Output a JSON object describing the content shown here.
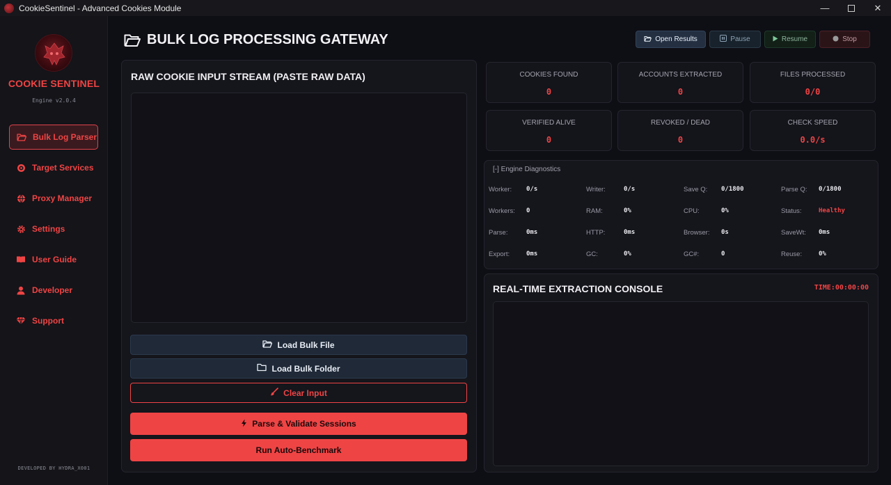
{
  "window": {
    "title": "CookieSentinel - Advanced Cookies Module"
  },
  "sidebar": {
    "brand": "COOKIE SENTINEL",
    "version": "Engine v2.0.4",
    "footer": "DEVELOPED BY HYDRA_X001",
    "items": [
      {
        "label": "Bulk Log Parser",
        "icon": "folder-open-icon",
        "active": true
      },
      {
        "label": "Target Services",
        "icon": "target-icon"
      },
      {
        "label": "Proxy Manager",
        "icon": "globe-icon"
      },
      {
        "label": "Settings",
        "icon": "gear-icon"
      },
      {
        "label": "User Guide",
        "icon": "book-icon"
      },
      {
        "label": "Developer",
        "icon": "user-icon"
      },
      {
        "label": "Support",
        "icon": "gem-icon"
      }
    ]
  },
  "header": {
    "title": "BULK LOG PROCESSING GATEWAY",
    "buttons": {
      "open_results": "Open Results",
      "pause": "Pause",
      "resume": "Resume",
      "stop": "Stop"
    }
  },
  "input_panel": {
    "title": "RAW COOKIE INPUT STREAM (PASTE RAW DATA)",
    "textarea_value": "",
    "buttons": {
      "load_file": "Load Bulk File",
      "load_folder": "Load Bulk Folder",
      "clear": "Clear Input",
      "parse": "Parse & Validate Sessions",
      "benchmark": "Run Auto-Benchmark"
    }
  },
  "stats": [
    {
      "label": "COOKIES FOUND",
      "value": "0"
    },
    {
      "label": "ACCOUNTS EXTRACTED",
      "value": "0"
    },
    {
      "label": "FILES PROCESSED",
      "value": "0/0"
    },
    {
      "label": "VERIFIED ALIVE",
      "value": "0"
    },
    {
      "label": "REVOKED / DEAD",
      "value": "0"
    },
    {
      "label": "CHECK SPEED",
      "value": "0.0/s"
    }
  ],
  "diagnostics": {
    "header": "[-] Engine Diagnostics",
    "rows": [
      [
        {
          "label": "Worker:",
          "value": "0/s"
        },
        {
          "label": "Writer:",
          "value": "0/s"
        },
        {
          "label": "Save Q:",
          "value": "0/1800"
        },
        {
          "label": "Parse Q:",
          "value": "0/1800"
        }
      ],
      [
        {
          "label": "Workers:",
          "value": "0"
        },
        {
          "label": "RAM:",
          "value": "0%"
        },
        {
          "label": "CPU:",
          "value": "0%"
        },
        {
          "label": "Status:",
          "value": "Healthy"
        }
      ],
      [
        {
          "label": "Parse:",
          "value": "0ms"
        },
        {
          "label": "HTTP:",
          "value": "0ms"
        },
        {
          "label": "Browser:",
          "value": "0s"
        },
        {
          "label": "SaveWt:",
          "value": "0ms"
        }
      ],
      [
        {
          "label": "Export:",
          "value": "0ms"
        },
        {
          "label": "GC:",
          "value": "0%"
        },
        {
          "label": "GC#:",
          "value": "0"
        },
        {
          "label": "Reuse:",
          "value": "0%"
        }
      ]
    ]
  },
  "console": {
    "title": "REAL-TIME EXTRACTION CONSOLE",
    "timer": "TIME:00:00:00"
  },
  "colors": {
    "accent": "#ef4444",
    "background": "#0e0e15",
    "panel": "#15151c",
    "button_dark": "#1f2937"
  }
}
